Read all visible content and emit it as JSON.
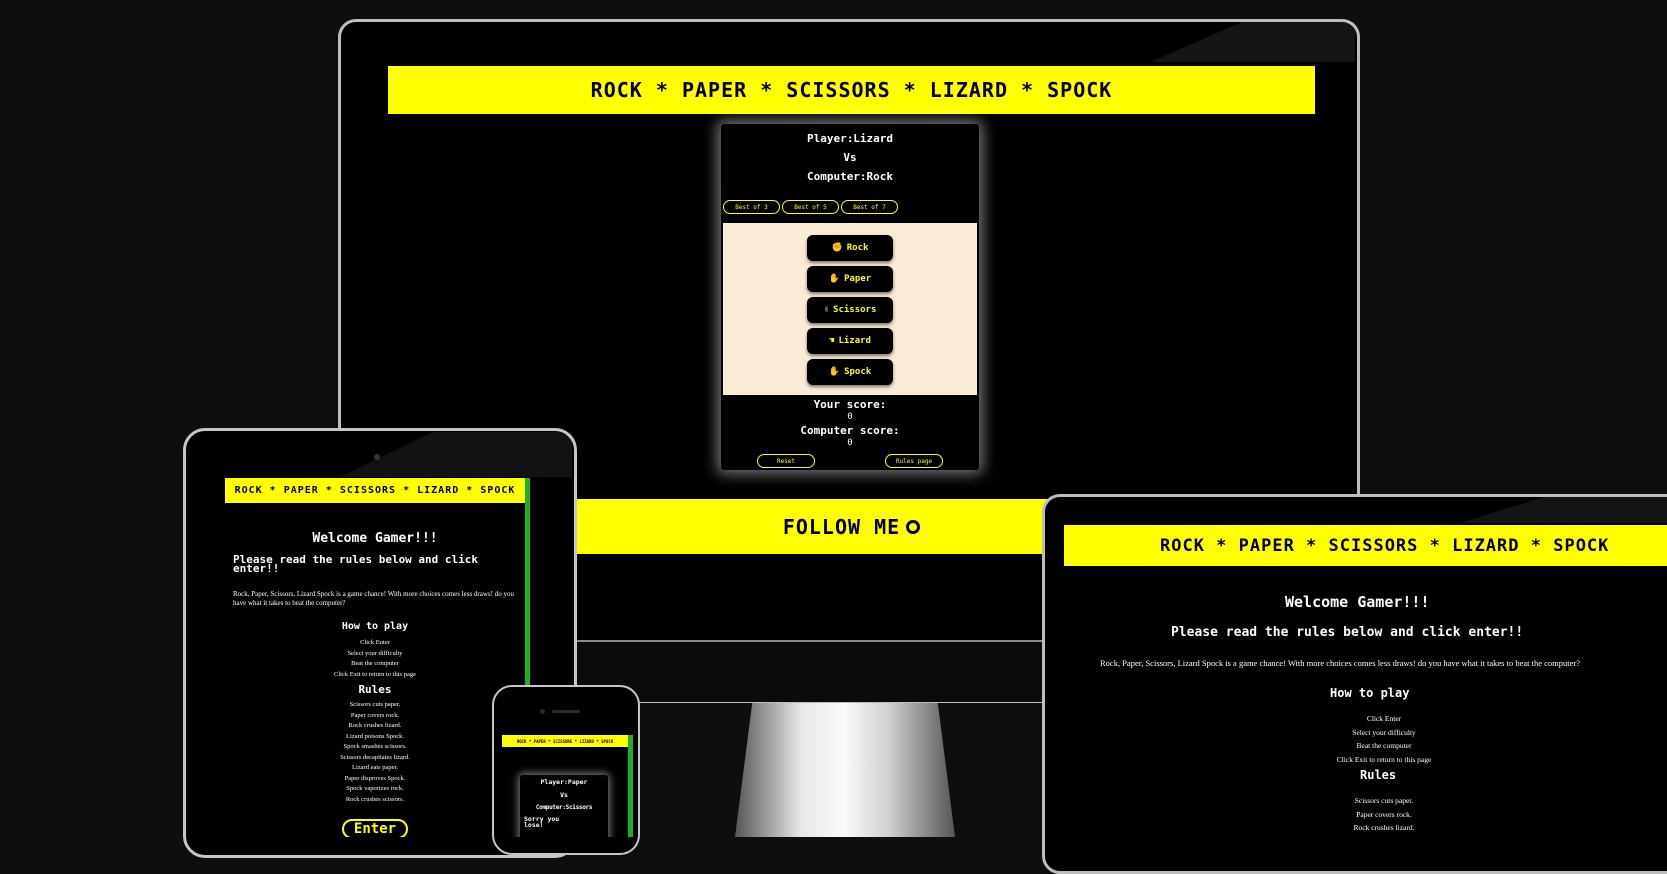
{
  "colors": {
    "accent": "#ffff00",
    "background": "#0e0e10",
    "panel": "#faebd7",
    "green": "#1fae24"
  },
  "site_title": "ROCK * PAPER * SCISSORS * LIZARD * SPOCK",
  "desktop": {
    "player_line": "Player:Lizard",
    "vs": "Vs",
    "computer_line": "Computer:Rock",
    "best_of": [
      "Best of 3",
      "Best of 5",
      "Best of 7"
    ],
    "choices": [
      {
        "icon": "hand-fist-icon",
        "glyph": "✊",
        "label": "Rock"
      },
      {
        "icon": "hand-paper-icon",
        "glyph": "✋",
        "label": "Paper"
      },
      {
        "icon": "hand-scissors-icon",
        "glyph": "✌",
        "label": "Scissors"
      },
      {
        "icon": "hand-lizard-icon",
        "glyph": "☚",
        "label": "Lizard"
      },
      {
        "icon": "hand-spock-icon",
        "glyph": "🖖",
        "label": "Spock"
      }
    ],
    "your_score_label": "Your score:",
    "your_score": "0",
    "computer_score_label": "Computer score:",
    "computer_score": "0",
    "reset_label": "Reset",
    "rules_label": "Rules page",
    "footer_label": "FOLLOW ME",
    "footer_icon": "github-icon"
  },
  "welcome": {
    "heading": "Welcome Gamer!!!",
    "subheading": "Please read the rules below and click enter!!",
    "intro": "Rock, Paper, Scissors, Lizard Spock is a game chance! With more choices comes less draws! do you have what it takes to beat the computer?",
    "how_to_play_heading": "How to play",
    "how_to_play": [
      "Click Enter",
      "Select your difficulty",
      "Beat the computer",
      "Click Exit to return to this page"
    ],
    "rules_heading": "Rules",
    "rules": [
      "Scissors cuts paper.",
      "Paper covers rock.",
      "Rock crushes lizard.",
      "Lizard poisons Spock.",
      "Spock smashes scissors.",
      "Scissors decapitates lizard.",
      "Lizard eats paper.",
      "Paper disproves Spock.",
      "Spock vaporizes rock.",
      "Rock crushes scissors."
    ],
    "enter_label": "Enter"
  },
  "tablet_intro": "Rock, Paper, Scissors, Lizard Spock is a game chance! With more choices comes less draws! do you have what it takes to beat the computer?",
  "phone": {
    "player_line": "Player:Paper",
    "vs": "Vs",
    "computer_line": "Computer:Scissors",
    "result": "Sorry you lose!"
  }
}
